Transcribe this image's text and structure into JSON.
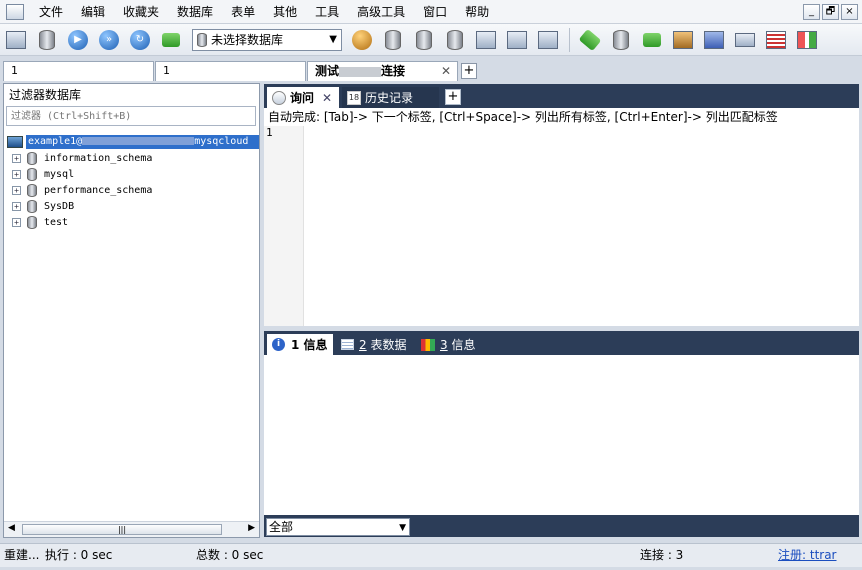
{
  "menu": [
    "文件",
    "编辑",
    "收藏夹",
    "数据库",
    "表单",
    "其他",
    "工具",
    "高级工具",
    "窗口",
    "帮助"
  ],
  "window_controls": [
    "_",
    "🗗",
    "×"
  ],
  "toolbar": {
    "db_select_value": "未选择数据库",
    "icons": [
      "new-connection-icon",
      "edit-connection-icon",
      "execute-query-icon",
      "execute-all-icon",
      "refresh-icon",
      "cancel-query-icon",
      "user-manager-icon",
      "import-icon",
      "export-icon",
      "backup-icon",
      "schema-sync-icon",
      "data-sync-icon",
      "copy-database-icon",
      "query-builder-icon",
      "table-schema-icon",
      "server-icon",
      "report-icon",
      "grid-view-icon",
      "designer-icon"
    ]
  },
  "connection_tabs": [
    {
      "label": "1"
    },
    {
      "label": "1"
    },
    {
      "label_start": "测试",
      "label_end": "连接",
      "active": true
    }
  ],
  "left_panel": {
    "title": "过滤器数据库",
    "filter_placeholder": "过滤器 (Ctrl+Shift+B)",
    "root": {
      "label_start": "example1@",
      "label_end": "mysqcloud"
    },
    "databases": [
      "information_schema",
      "mysql",
      "performance_schema",
      "SysDB",
      "test"
    ],
    "scroll_grip": "|||"
  },
  "query_tabs": [
    {
      "label": "询问",
      "active": true
    },
    {
      "label": "历史记录"
    }
  ],
  "query_hint": "自动完成: [Tab]-> 下一个标签, [Ctrl+Space]-> 列出所有标签, [Ctrl+Enter]-> 列出匹配标签",
  "editor": {
    "line_numbers": [
      "1"
    ]
  },
  "result_tabs": [
    {
      "num": "1",
      "label": "信息",
      "active": true
    },
    {
      "num": "2",
      "label": "表数据"
    },
    {
      "num": "3",
      "label": "信息"
    }
  ],
  "result_scope": "全部",
  "statusbar": {
    "status": "重建...",
    "exec_time": "执行 : 0 sec",
    "total_time": "总数 : 0 sec",
    "connections": "连接 : 3",
    "register": "注册:  ttrar"
  }
}
